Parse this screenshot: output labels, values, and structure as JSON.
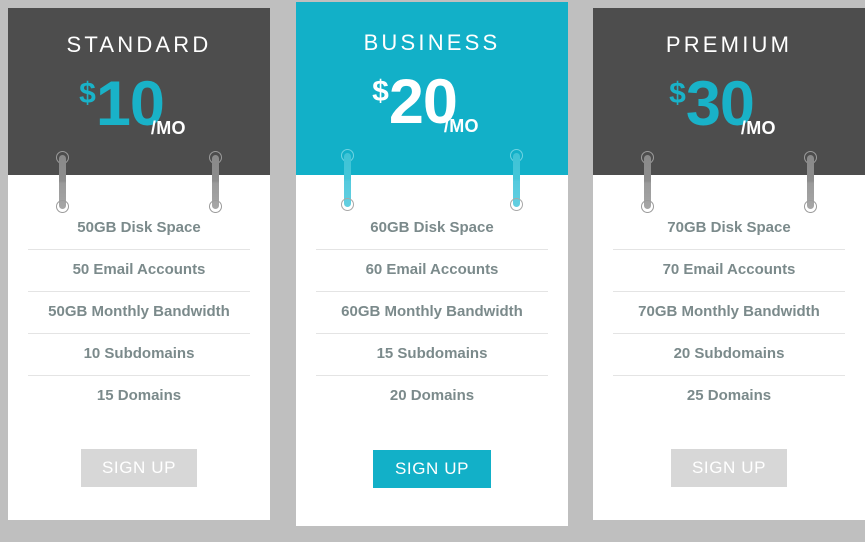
{
  "page": {
    "background_color": "#bfbfbf",
    "title": "Pricing Table"
  },
  "theme": {
    "accent_color": "#12b0c8",
    "dark_header_color": "#4d4d4d",
    "price_accent_color": "#19b2c8",
    "feature_text_color": "#7b8a8b",
    "separator_color": "#e4e4e4",
    "button_muted_color": "#d7d7d7",
    "card_background": "#ffffff"
  },
  "plans": [
    {
      "id": "standard",
      "name": "STANDARD",
      "featured": false,
      "currency": "$",
      "amount": "10",
      "period": "/MO",
      "features": [
        "50GB Disk Space",
        "50 Email Accounts",
        "50GB Monthly Bandwidth",
        "10 Subdomains",
        "15 Domains"
      ],
      "cta_label": "SIGN UP"
    },
    {
      "id": "business",
      "name": "BUSINESS",
      "featured": true,
      "currency": "$",
      "amount": "20",
      "period": "/MO",
      "features": [
        "60GB Disk Space",
        "60 Email Accounts",
        "60GB Monthly Bandwidth",
        "15 Subdomains",
        "20 Domains"
      ],
      "cta_label": "SIGN UP"
    },
    {
      "id": "premium",
      "name": "PREMIUM",
      "featured": false,
      "currency": "$",
      "amount": "30",
      "period": "/MO",
      "features": [
        "70GB Disk Space",
        "70 Email Accounts",
        "70GB Monthly Bandwidth",
        "20 Subdomains",
        "25 Domains"
      ],
      "cta_label": "SIGN UP"
    }
  ]
}
